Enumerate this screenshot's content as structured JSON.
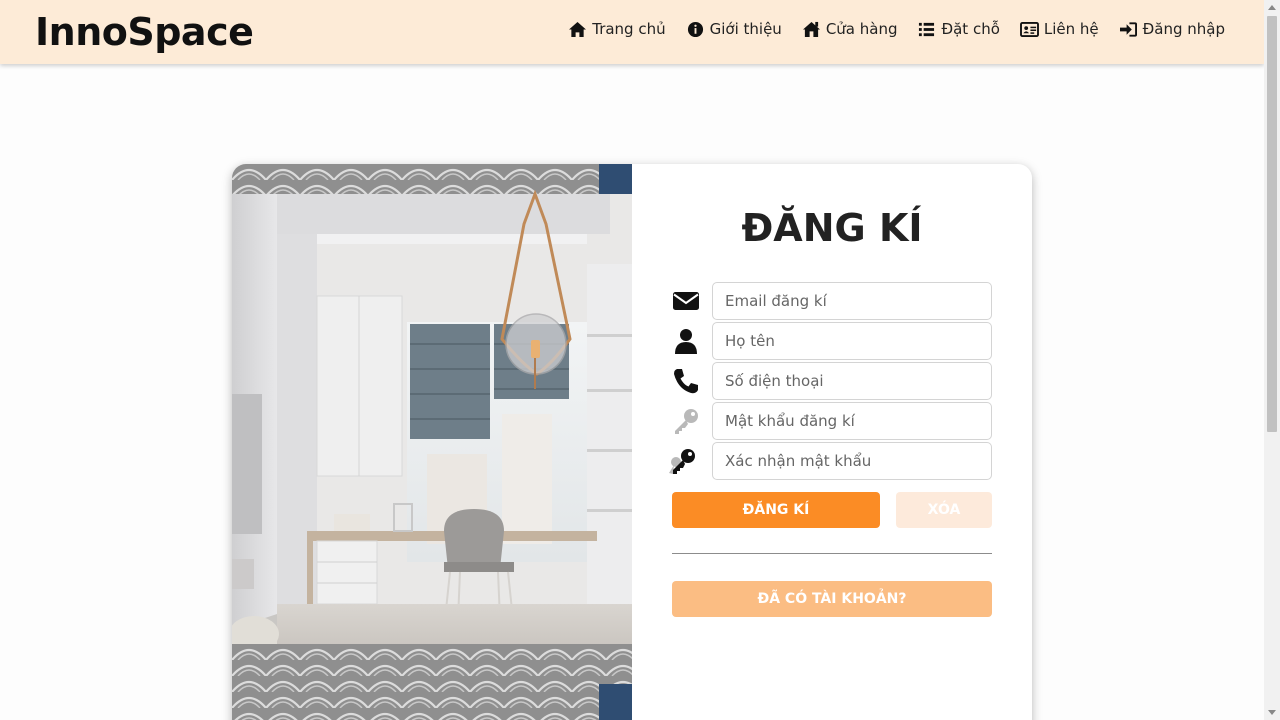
{
  "brand": "InnoSpace",
  "nav": [
    {
      "label": "Trang chủ",
      "icon": "home-icon"
    },
    {
      "label": "Giới thiệu",
      "icon": "info-circle-icon"
    },
    {
      "label": "Cửa hàng",
      "icon": "store-icon"
    },
    {
      "label": "Đặt chỗ",
      "icon": "list-icon"
    },
    {
      "label": "Liên hệ",
      "icon": "contact-card-icon"
    },
    {
      "label": "Đăng nhập",
      "icon": "sign-in-icon"
    }
  ],
  "form": {
    "title": "ĐĂNG KÍ",
    "email_placeholder": "Email đăng kí",
    "name_placeholder": "Họ tên",
    "phone_placeholder": "Số điện thoại",
    "password_placeholder": "Mật khẩu đăng kí",
    "confirm_placeholder": "Xác nhận mật khẩu",
    "register_label": "ĐĂNG KÍ",
    "clear_label": "XÓA",
    "have_account_label": "ĐÃ CÓ TÀI KHOẢN?"
  },
  "colors": {
    "navbar_bg": "#fdebd7",
    "primary_orange": "#fb8c25",
    "light_orange": "#fbbd83",
    "pale_orange": "#fdeadb"
  }
}
